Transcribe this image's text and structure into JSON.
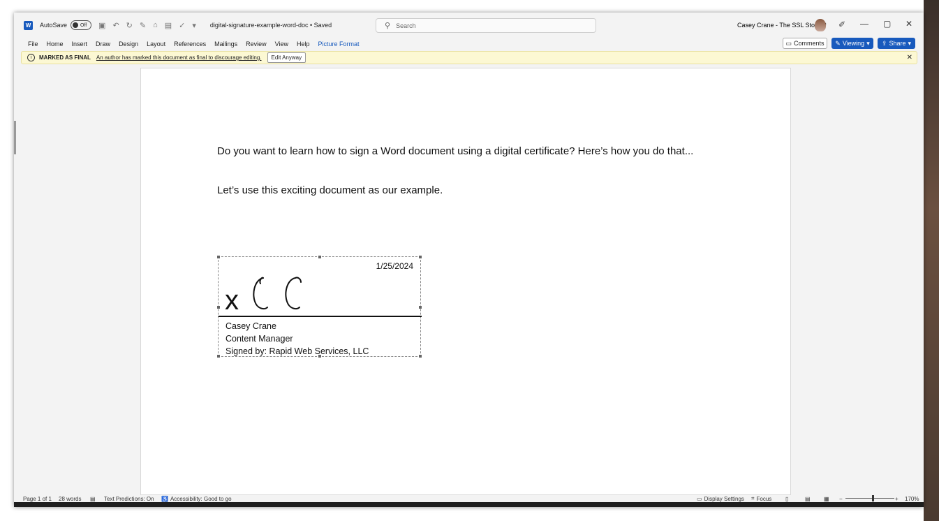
{
  "titlebar": {
    "autosave_label": "AutoSave",
    "autosave_state": "Off",
    "doc_title": "digital-signature-example-word-doc • Saved",
    "search_placeholder": "Search",
    "user_name": "Casey Crane - The SSL Store™"
  },
  "ribbon": {
    "tabs": [
      "File",
      "Home",
      "Insert",
      "Draw",
      "Design",
      "Layout",
      "References",
      "Mailings",
      "Review",
      "View",
      "Help",
      "Picture Format"
    ],
    "comments_label": "Comments",
    "viewing_label": "Viewing",
    "share_label": "Share"
  },
  "infobar": {
    "title": "MARKED AS FINAL",
    "message": "An author has marked this document as final to discourage editing.",
    "button_label": "Edit Anyway"
  },
  "document": {
    "paragraph1": "Do you want to learn how to sign a Word document using a digital certificate? Here’s how you do that...",
    "paragraph2": "Let’s use this exciting document as our example.",
    "signature": {
      "date": "1/25/2024",
      "x_mark": "x",
      "signer_name": "Casey Crane",
      "signer_title": "Content Manager",
      "signed_by": "Signed by: Rapid Web Services, LLC"
    }
  },
  "statusbar": {
    "page": "Page 1 of 1",
    "words": "28 words",
    "text_predictions": "Text Predictions: On",
    "accessibility": "Accessibility: Good to go",
    "display_settings": "Display Settings",
    "focus": "Focus",
    "zoom": "170%"
  },
  "colors": {
    "accent": "#185abd",
    "infobar_bg": "#fcf8d3"
  }
}
